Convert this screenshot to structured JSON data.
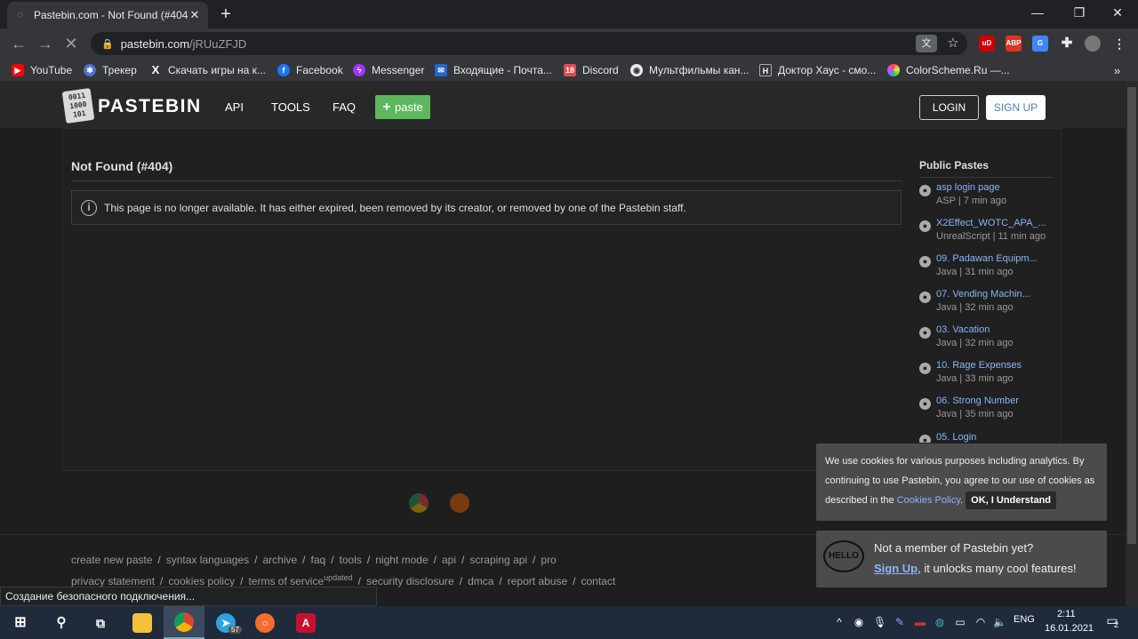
{
  "browser": {
    "tab_title": "Pastebin.com - Not Found (#404)",
    "tab_close": "✕",
    "new_tab": "+",
    "url_host": "pastebin.com",
    "url_path": "/jRUuZFJD",
    "bookmarks": [
      {
        "label": "YouTube",
        "icon": "youtube-icon",
        "color": "#ff0000"
      },
      {
        "label": "Трекер",
        "icon": "tracker-icon",
        "color": "#4a6fd6"
      },
      {
        "label": "Скачать игры на к...",
        "icon": "x-icon",
        "color": "#35363a"
      },
      {
        "label": "Facebook",
        "icon": "facebook-icon",
        "color": "#1877f2"
      },
      {
        "label": "Messenger",
        "icon": "messenger-icon",
        "color": "#a334fa"
      },
      {
        "label": "Входящие - Почта...",
        "icon": "mail-icon",
        "color": "#2266cc"
      },
      {
        "label": "Discord",
        "icon": "discord-icon",
        "color": "#e04c4c"
      },
      {
        "label": "Мультфильмы кан...",
        "icon": "globe-icon",
        "color": "#e8eaed"
      },
      {
        "label": "Доктор Хаус - смо...",
        "icon": "h-icon",
        "color": "#4a6fd6"
      },
      {
        "label": "ColorScheme.Ru —...",
        "icon": "colorscheme-icon",
        "color": "#e040fb"
      }
    ]
  },
  "site": {
    "logo_text": "PASTEBIN",
    "logo_bits": "0011 1000 101",
    "nav": [
      "API",
      "TOOLS",
      "FAQ"
    ],
    "paste_button": "paste",
    "login": "LOGIN",
    "signup": "SIGN UP"
  },
  "main": {
    "title": "Not Found (#404)",
    "notice": "This page is no longer available. It has either expired, been removed by its creator, or removed by one of the Pastebin staff."
  },
  "public_pastes": {
    "title": "Public Pastes",
    "items": [
      {
        "name": "asp login page",
        "meta": "ASP | 7 min ago"
      },
      {
        "name": "X2Effect_WOTC_APA_...",
        "meta": "UnrealScript | 11 min ago"
      },
      {
        "name": "09. Padawan Equipm...",
        "meta": "Java | 31 min ago"
      },
      {
        "name": "07. Vending Machin...",
        "meta": "Java | 32 min ago"
      },
      {
        "name": "03. Vacation",
        "meta": "Java | 32 min ago"
      },
      {
        "name": "10. Rage Expenses",
        "meta": "Java | 33 min ago"
      },
      {
        "name": "06. Strong Number",
        "meta": "Java | 35 min ago"
      },
      {
        "name": "05. Login",
        "meta": ""
      }
    ]
  },
  "footer": {
    "row1": [
      "create new paste",
      "syntax languages",
      "archive",
      "faq",
      "tools",
      "night mode",
      "api",
      "scraping api",
      "pro"
    ],
    "row2": [
      "privacy statement",
      "cookies policy",
      "terms of service",
      "security disclosure",
      "dmca",
      "report abuse",
      "contact"
    ],
    "updated": "updated"
  },
  "cookie": {
    "text1": "We use cookies for various purposes including analytics. By continuing to use Pastebin, you agree to our use of cookies as described in the ",
    "link": "Cookies Policy",
    "dot": ".",
    "button": "OK, I Understand"
  },
  "member": {
    "hello": "HELLO",
    "line1": "Not a member of Pastebin yet?",
    "signup": "Sign Up",
    "line2": ", it unlocks many cool features!"
  },
  "status": "Создание безопасного подключения...",
  "taskbar": {
    "lang": "ENG",
    "time": "2:11",
    "date": "16.01.2021",
    "notifications": "2",
    "telegram_badge": "57"
  }
}
